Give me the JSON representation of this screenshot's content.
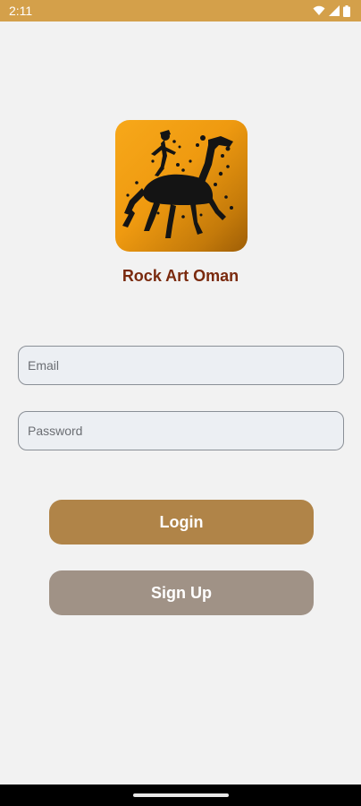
{
  "status_bar": {
    "time": "2:11",
    "icons": [
      "wifi-icon",
      "signal-icon",
      "battery-icon"
    ],
    "color": "#d4a04a"
  },
  "app": {
    "title": "Rock Art Oman",
    "logo_icon": "rock-art-figure-logo"
  },
  "form": {
    "email_placeholder": "Email",
    "email_value": "",
    "password_placeholder": "Password",
    "password_value": ""
  },
  "buttons": {
    "login_label": "Login",
    "signup_label": "Sign Up"
  },
  "colors": {
    "accent": "#b08448",
    "secondary": "#a09286",
    "title": "#7a2a0e",
    "background": "#f2f2f2"
  }
}
